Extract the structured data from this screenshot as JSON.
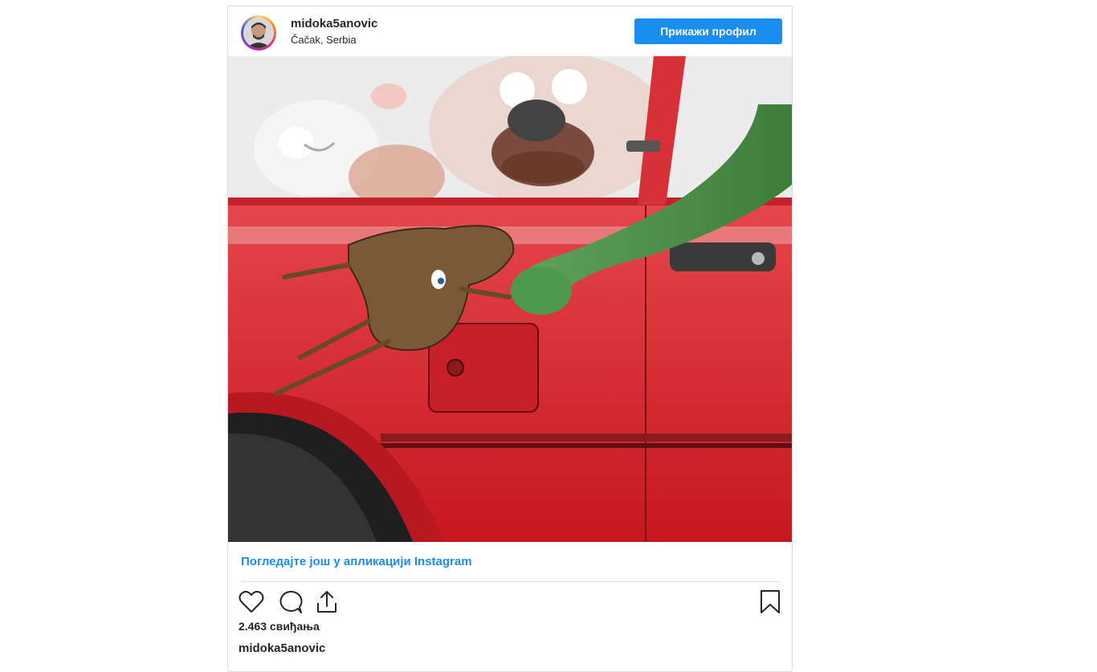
{
  "post": {
    "username": "midoka5anovic",
    "location": "Čačak, Serbia",
    "view_profile_label": "Прикажи профил",
    "view_more_link": "Погледајте још у апликацији Instagram",
    "likes_text": "2.463 свиђања",
    "caption_username": "midoka5anovic"
  },
  "icons": {
    "like": "heart-icon",
    "comment": "comment-icon",
    "share": "share-icon",
    "save": "bookmark-icon"
  },
  "colors": {
    "accent": "#1a8df0",
    "text": "#262626",
    "border": "#dbdbdb"
  }
}
